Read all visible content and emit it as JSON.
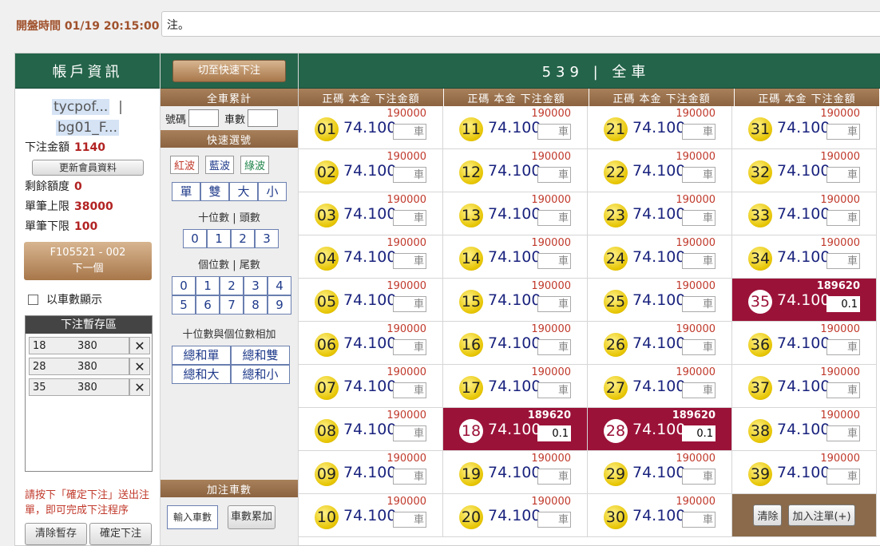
{
  "top": {
    "open_time": "開盤時間 01/19 20:15:00",
    "notice": "注。"
  },
  "account": {
    "title": "帳戶資訊",
    "user_line1": "tycpof...",
    "user_line2": "bg01_F...",
    "bet_amount_label": "下注金額",
    "bet_amount": "1140",
    "refresh_label": "更新會員資料",
    "remaining_label": "剩餘額度",
    "remaining": "0",
    "max_label": "單筆上限",
    "max": "38000",
    "min_label": "單筆下限",
    "min": "100",
    "next_line1": "F105521 - 002",
    "next_line2": "下一個",
    "by_count_label": "以車數顯示",
    "temp_title": "下注暫存區",
    "temp_rows": [
      {
        "num": "18",
        "amt": "380"
      },
      {
        "num": "28",
        "amt": "380"
      },
      {
        "num": "35",
        "amt": "380"
      }
    ],
    "confirm_tip": "請按下「確定下注」送出注單，即可完成下注程序",
    "clear_temp_label": "清除暫存",
    "confirm_label": "確定下注"
  },
  "middle": {
    "quick_switch": "切至快速下注",
    "cum_title": "全車累計",
    "num_label": "號碼",
    "count_label": "車數",
    "quick_title": "快速選號",
    "waves": [
      "紅波",
      "藍波",
      "綠波"
    ],
    "odd_even": [
      "單",
      "雙",
      "大",
      "小"
    ],
    "tens_label": "十位數 | 頭數",
    "tens": [
      "0",
      "1",
      "2",
      "3"
    ],
    "units_label": "個位數 | 尾數",
    "units_row1": [
      "0",
      "1",
      "2",
      "3",
      "4"
    ],
    "units_row2": [
      "5",
      "6",
      "7",
      "8",
      "9"
    ],
    "sum_label": "十位數與個位數相加",
    "sums": [
      "總和單",
      "總和雙",
      "總和大",
      "總和小"
    ],
    "add_title": "加注車數",
    "add_placeholder": "輸入車數",
    "add_cum_label": "車數累加"
  },
  "grid": {
    "title": "539 | 全車",
    "col_head": "正碼  本金  下注金額",
    "odds": "74.100",
    "default_limit": "190000",
    "bet_placeholder": "車",
    "selected_limit": "189620",
    "selected_bet": "0.1",
    "selected": [
      "18",
      "28",
      "35"
    ],
    "clear_label": "清除",
    "add_order_label": "加入注單(+)"
  },
  "colors": {
    "header_green": "#24644a",
    "brown": "#a8774a",
    "selected_red": "#9b1238",
    "ball_yellow": "#e6c400"
  }
}
